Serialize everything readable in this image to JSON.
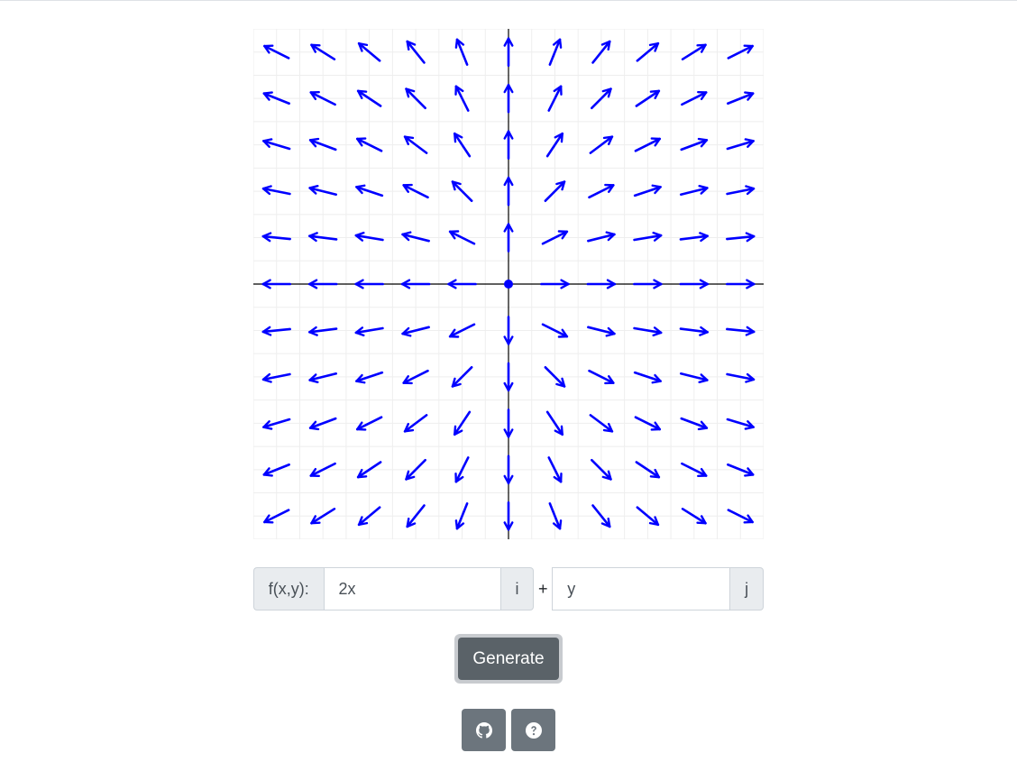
{
  "field_prefix_label": "f(x,y):",
  "i_component": {
    "value": "2x",
    "unit_label": "i"
  },
  "plus_label": "+",
  "j_component": {
    "value": "y",
    "unit_label": "j"
  },
  "generate_label": "Generate",
  "icons": {
    "github": "github-icon",
    "help": "question-circle-icon"
  },
  "colors": {
    "vector": "#0000ff",
    "axis": "#000000",
    "grid": "#eeeeee",
    "button": "#5a6268",
    "icon_button": "#6c757d"
  },
  "chart_data": {
    "type": "vector_field",
    "fx": "2x",
    "fy": "y",
    "x_range": [
      -5,
      5
    ],
    "y_range": [
      -5,
      5
    ],
    "grid": true
  }
}
